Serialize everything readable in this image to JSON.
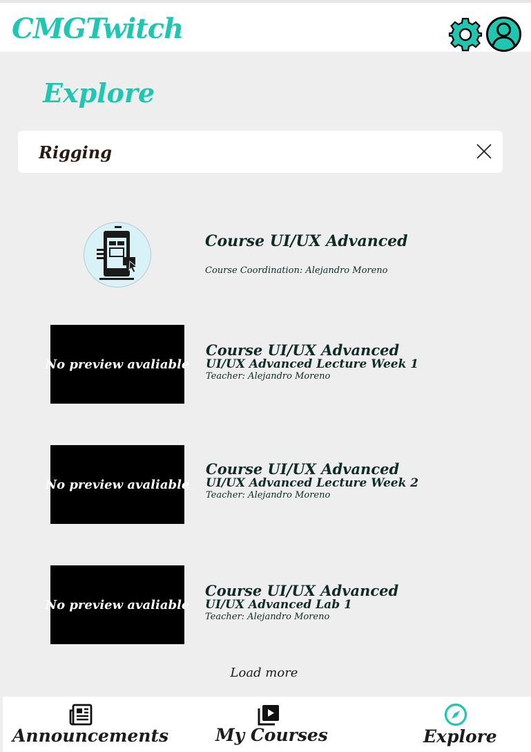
{
  "header": {
    "brand": "CMGTwitch",
    "settings_icon": "gear-icon",
    "profile_icon": "user-circle-icon"
  },
  "page": {
    "title": "Explore"
  },
  "search": {
    "value": "Rigging",
    "clear_icon": "close-icon"
  },
  "results": [
    {
      "kind": "course",
      "title": "Course UI/UX Advanced",
      "meta": "Course Coordination: Alejandro Moreno",
      "thumb_icon": "phone-design-icon"
    },
    {
      "kind": "lesson",
      "thumb_text": "No preview avaliable",
      "title": "Course UI/UX Advanced",
      "subtitle": "UI/UX Advanced Lecture Week 1",
      "meta": "Teacher: Alejandro Moreno"
    },
    {
      "kind": "lesson",
      "thumb_text": "No preview avaliable",
      "title": "Course UI/UX Advanced",
      "subtitle": "UI/UX Advanced Lecture Week 2",
      "meta": "Teacher: Alejandro Moreno"
    },
    {
      "kind": "lesson",
      "thumb_text": "No preview avaliable",
      "title": "Course UI/UX Advanced",
      "subtitle": "UI/UX Advanced Lab 1",
      "meta": "Teacher: Alejandro Moreno"
    }
  ],
  "load_more": "Load more",
  "nav": {
    "announcements": {
      "label": "Announcements",
      "icon": "newspaper-icon"
    },
    "my_courses": {
      "label": "My Courses",
      "icon": "video-library-icon"
    },
    "explore": {
      "label": "Explore",
      "icon": "compass-icon",
      "active": true
    }
  },
  "colors": {
    "accent": "#1fc7b0",
    "background": "#eeeeee",
    "text": "#0e2b26"
  }
}
